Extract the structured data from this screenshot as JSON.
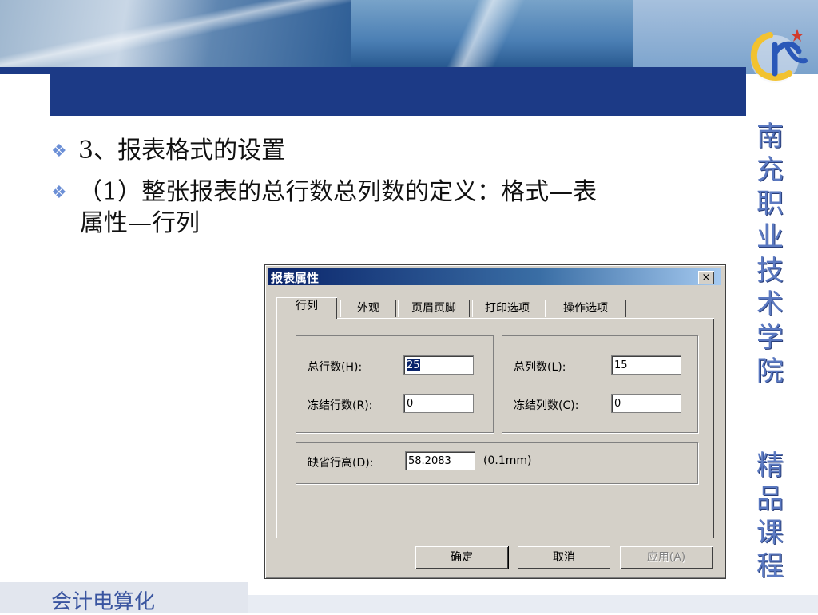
{
  "slide": {
    "vertical_title": [
      "南",
      "充",
      "职",
      "业",
      "技",
      "术",
      "学",
      "院"
    ],
    "vertical_subtitle": [
      "精",
      "品",
      "课",
      "程"
    ],
    "bullets": [
      {
        "text": "3、报表格式的设置"
      },
      {
        "text": "（1）整张报表的总行数总列数的定义：格式—表",
        "continuation": "属性—行列"
      }
    ],
    "footer_text": "会计电算化",
    "logo_icon": "college-logo-icon"
  },
  "dialog": {
    "title": "报表属性",
    "close_label": "×",
    "tabs": [
      {
        "label": "行列",
        "active": true
      },
      {
        "label": "外观",
        "active": false
      },
      {
        "label": "页眉页脚",
        "active": false
      },
      {
        "label": "打印选项",
        "active": false
      },
      {
        "label": "操作选项",
        "active": false
      }
    ],
    "fields": {
      "total_rows": {
        "label": "总行数(H):",
        "value": "25"
      },
      "frozen_rows": {
        "label": "冻结行数(R):",
        "value": "0"
      },
      "total_cols": {
        "label": "总列数(L):",
        "value": "15"
      },
      "frozen_cols": {
        "label": "冻结列数(C):",
        "value": "0"
      },
      "default_row_height": {
        "label": "缺省行高(D):",
        "value": "58.2083",
        "unit": "(0.1mm)"
      }
    },
    "buttons": {
      "ok": "确定",
      "cancel": "取消",
      "apply": "应用(A)"
    }
  }
}
